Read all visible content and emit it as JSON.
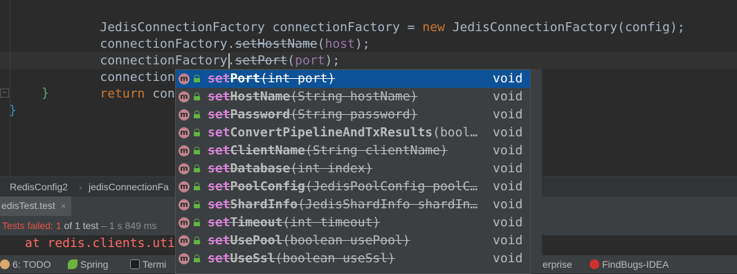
{
  "editor": {
    "line1": {
      "pre": "JedisConnectionFactory connectionFactory = ",
      "kw": "new",
      "post": " JedisConnectionFactory(config);"
    },
    "line2": {
      "pre": "connectionFactory.",
      "method": "setHostName",
      "post1": "(",
      "arg": "host",
      "post2": ");"
    },
    "line3": {
      "pre": "connectionFactory.",
      "method": "setPort",
      "post1": "(",
      "arg": "port",
      "post2": ");"
    },
    "line4": {
      "text": "connectionFactory.set"
    },
    "line5": {
      "kw": "return",
      "rest": " connect"
    },
    "close_inner": "}",
    "close_outer": "}"
  },
  "completion": {
    "items": [
      {
        "match": "set",
        "name": "Port",
        "args": "(int port)",
        "type": "void",
        "deprecated": true,
        "selected": true
      },
      {
        "match": "set",
        "name": "HostName",
        "args": "(String hostName)",
        "type": "void",
        "deprecated": true
      },
      {
        "match": "set",
        "name": "Password",
        "args": "(String password)",
        "type": "void",
        "deprecated": true
      },
      {
        "match": "set",
        "name": "ConvertPipelineAndTxResults",
        "args": "(bool…",
        "type": "void",
        "deprecated": false
      },
      {
        "match": "set",
        "name": "ClientName",
        "args": "(String clientName)",
        "type": "void",
        "deprecated": true
      },
      {
        "match": "set",
        "name": "Database",
        "args": "(int index)",
        "type": "void",
        "deprecated": true
      },
      {
        "match": "set",
        "name": "PoolConfig",
        "args": "(JedisPoolConfig poolC…",
        "type": "void",
        "deprecated": true
      },
      {
        "match": "set",
        "name": "ShardInfo",
        "args": "(JedisShardInfo shardIn…",
        "type": "void",
        "deprecated": true
      },
      {
        "match": "set",
        "name": "Timeout",
        "args": "(int timeout)",
        "type": "void",
        "deprecated": true
      },
      {
        "match": "set",
        "name": "UsePool",
        "args": "(boolean usePool)",
        "type": "void",
        "deprecated": true
      },
      {
        "match": "set",
        "name": "UseSsl",
        "args": "(boolean useSsl)",
        "type": "void",
        "deprecated": true
      }
    ],
    "icon_letter": "m"
  },
  "breadcrumb": {
    "item1": "RedisConfig2",
    "sep": "›",
    "item2": "jedisConnectionFa"
  },
  "run": {
    "tab_label": "edisTest.test",
    "close": "×"
  },
  "test_status": {
    "failed": "Tests failed: 1",
    "of": " of 1 test",
    "time": " – 1 s 849 ms"
  },
  "console": {
    "text": "at redis.clients.uti"
  },
  "toolwindows": {
    "todo": "6: TODO",
    "spring": "Spring",
    "terminal": "Termi",
    "enterprise": "erprise",
    "findbugs": "FindBugs-IDEA"
  },
  "colors": {
    "selection": "#0d5296",
    "match": "#d985d9",
    "method_icon": "#c0838d"
  }
}
